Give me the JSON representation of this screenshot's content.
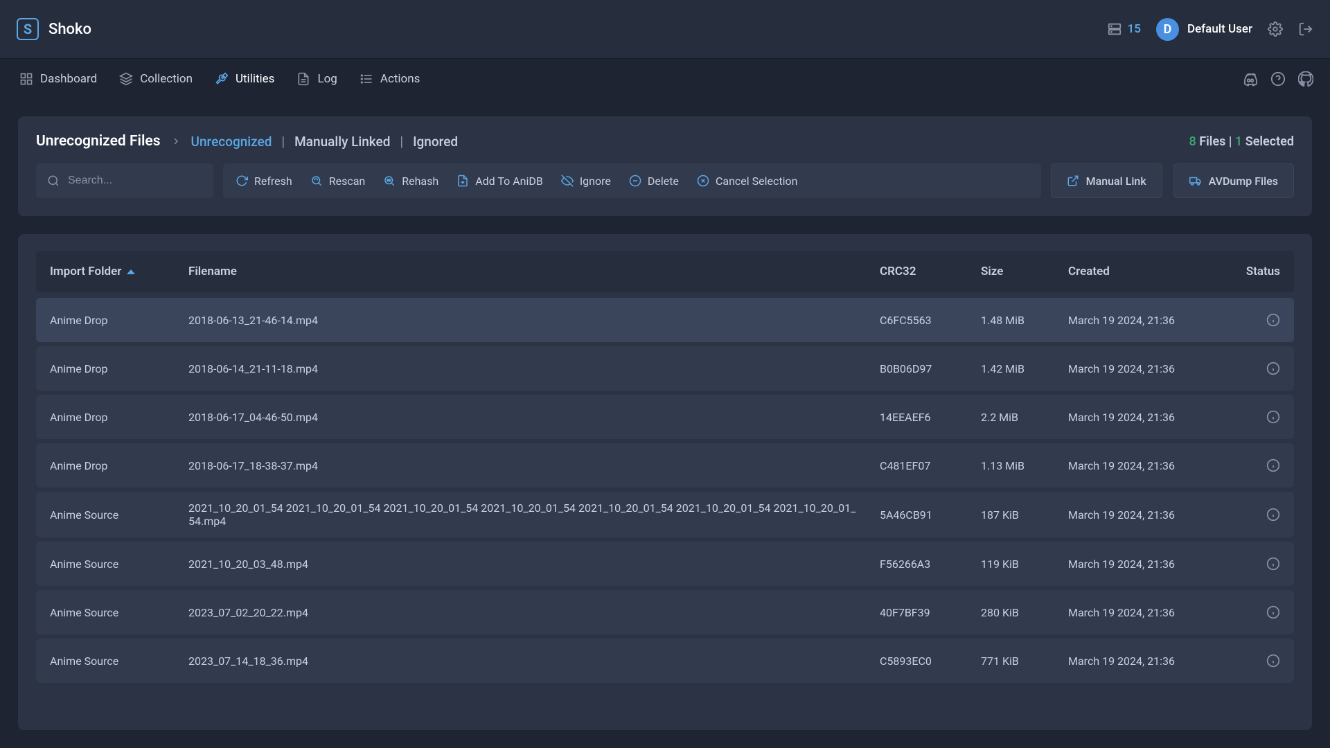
{
  "app": {
    "logo_letter": "S",
    "name": "Shoko",
    "queue_count": "15",
    "user_initial": "D",
    "user_name": "Default User"
  },
  "nav": {
    "items": [
      {
        "id": "dashboard",
        "label": "Dashboard"
      },
      {
        "id": "collection",
        "label": "Collection"
      },
      {
        "id": "utilities",
        "label": "Utilities"
      },
      {
        "id": "log",
        "label": "Log"
      },
      {
        "id": "actions",
        "label": "Actions"
      }
    ],
    "active_id": "utilities"
  },
  "page": {
    "breadcrumb_title": "Unrecognized Files",
    "tabs": [
      "Unrecognized",
      "Manually Linked",
      "Ignored"
    ],
    "active_tab_index": 0,
    "files_count": "8",
    "files_label_suffix": "Files",
    "separator": "|",
    "selected_count": "1",
    "selected_label_suffix": "Selected",
    "search_placeholder": "Search...",
    "actions": [
      "Refresh",
      "Rescan",
      "Rehash",
      "Add To AniDB",
      "Ignore",
      "Delete",
      "Cancel Selection"
    ],
    "manual_link_label": "Manual Link",
    "avdump_label": "AVDump Files"
  },
  "table": {
    "headers": {
      "import_folder": "Import Folder",
      "filename": "Filename",
      "crc32": "CRC32",
      "size": "Size",
      "created": "Created",
      "status": "Status"
    },
    "rows": [
      {
        "selected": true,
        "folder": "Anime Drop",
        "filename": "2018-06-13_21-46-14.mp4",
        "crc": "C6FC5563",
        "size": "1.48 MiB",
        "created": "March 19 2024, 21:36"
      },
      {
        "selected": false,
        "folder": "Anime Drop",
        "filename": "2018-06-14_21-11-18.mp4",
        "crc": "B0B06D97",
        "size": "1.42 MiB",
        "created": "March 19 2024, 21:36"
      },
      {
        "selected": false,
        "folder": "Anime Drop",
        "filename": "2018-06-17_04-46-50.mp4",
        "crc": "14EEAEF6",
        "size": "2.2 MiB",
        "created": "March 19 2024, 21:36"
      },
      {
        "selected": false,
        "folder": "Anime Drop",
        "filename": "2018-06-17_18-38-37.mp4",
        "crc": "C481EF07",
        "size": "1.13 MiB",
        "created": "March 19 2024, 21:36"
      },
      {
        "selected": false,
        "folder": "Anime Source",
        "filename": "2021_10_20_01_54 2021_10_20_01_54 2021_10_20_01_54 2021_10_20_01_54 2021_10_20_01_54 2021_10_20_01_54 2021_10_20_01_54.mp4",
        "crc": "5A46CB91",
        "size": "187 KiB",
        "created": "March 19 2024, 21:36"
      },
      {
        "selected": false,
        "folder": "Anime Source",
        "filename": "2021_10_20_03_48.mp4",
        "crc": "F56266A3",
        "size": "119 KiB",
        "created": "March 19 2024, 21:36"
      },
      {
        "selected": false,
        "folder": "Anime Source",
        "filename": "2023_07_02_20_22.mp4",
        "crc": "40F7BF39",
        "size": "280 KiB",
        "created": "March 19 2024, 21:36"
      },
      {
        "selected": false,
        "folder": "Anime Source",
        "filename": "2023_07_14_18_36.mp4",
        "crc": "C5893EC0",
        "size": "771 KiB",
        "created": "March 19 2024, 21:36"
      }
    ]
  }
}
